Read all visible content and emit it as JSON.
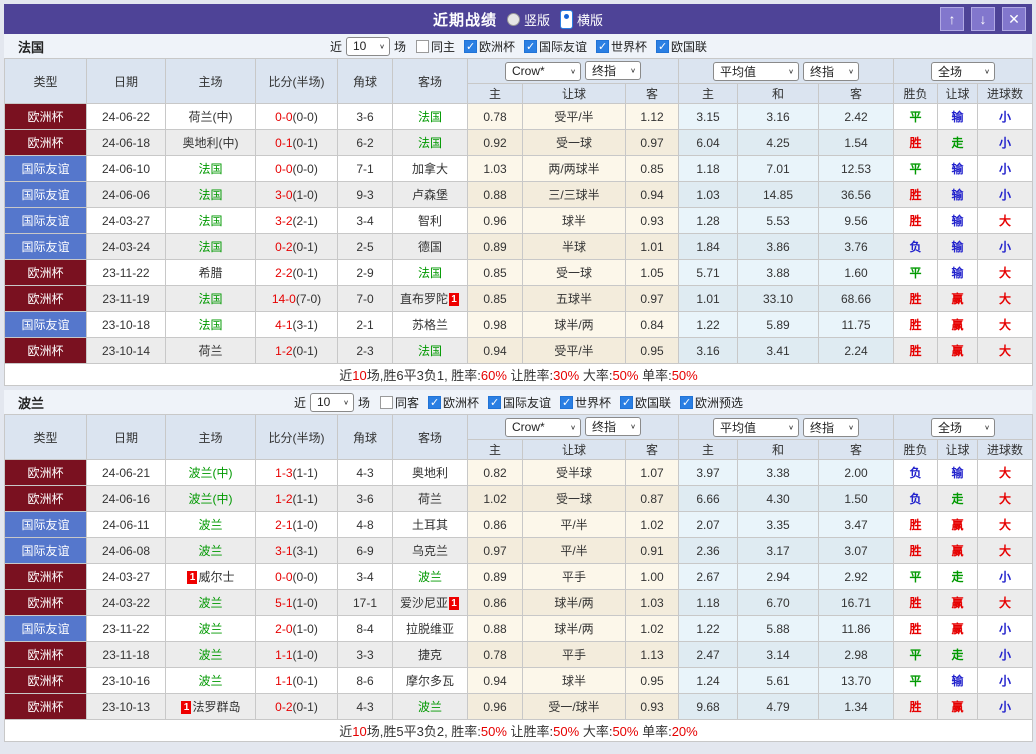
{
  "titlebar": {
    "title": "近期战绩",
    "layout_options": [
      {
        "label": "竖版",
        "selected": false
      },
      {
        "label": "横版",
        "selected": true
      }
    ],
    "buttons": [
      {
        "name": "move-up",
        "glyph": "↑"
      },
      {
        "name": "move-down",
        "glyph": "↓"
      },
      {
        "name": "close",
        "glyph": "✕"
      }
    ]
  },
  "table_header": {
    "static_cols": [
      "类型",
      "日期",
      "主场",
      "比分(半场)",
      "角球",
      "客场"
    ],
    "odds_group": {
      "selects": [
        "Crow*",
        "终指"
      ],
      "sub": [
        "主",
        "让球",
        "客"
      ]
    },
    "avg_group": {
      "selects": [
        "平均值",
        "终指"
      ],
      "sub": [
        "主",
        "和",
        "客"
      ]
    },
    "result_group": {
      "selects": [
        "全场"
      ],
      "sub": [
        "胜负",
        "让球",
        "进球数"
      ]
    }
  },
  "colors": {
    "titlebar_bg": "#4e4397",
    "type": {
      "欧洲杯": "#7a1120",
      "国际友谊": "#5577cc"
    },
    "result": {
      "胜": "#e60000",
      "平": "#009900",
      "负": "#2222cc",
      "赢": "#e60000",
      "走": "#009900",
      "输": "#2222cc",
      "大": "#e60000",
      "小": "#2222cc"
    },
    "team_green": "#009900",
    "score_red": "#e60000"
  },
  "card_glyph": "1",
  "sections": [
    {
      "team": "法国",
      "filter": {
        "prefix": "近",
        "count": "10",
        "suffix": "场",
        "same": {
          "label": "同主",
          "checked": false
        },
        "leagues": [
          {
            "label": "欧洲杯",
            "checked": true
          },
          {
            "label": "国际友谊",
            "checked": true
          },
          {
            "label": "世界杯",
            "checked": true
          },
          {
            "label": "欧国联",
            "checked": true
          }
        ]
      },
      "rows": [
        {
          "t": "欧洲杯",
          "d": "24-06-22",
          "h": "荷兰(中)",
          "hg": false,
          "hc": false,
          "s": "0-0",
          "sh": "0-0",
          "c": "3-6",
          "a": "法国",
          "ag": true,
          "ac": false,
          "o": [
            "0.78",
            "受平/半",
            "1.12"
          ],
          "m": [
            "3.15",
            "3.16",
            "2.42"
          ],
          "r": [
            "平",
            "输",
            "小"
          ]
        },
        {
          "t": "欧洲杯",
          "d": "24-06-18",
          "h": "奥地利(中)",
          "hg": false,
          "hc": false,
          "s": "0-1",
          "sh": "0-1",
          "c": "6-2",
          "a": "法国",
          "ag": true,
          "ac": false,
          "o": [
            "0.92",
            "受一球",
            "0.97"
          ],
          "m": [
            "6.04",
            "4.25",
            "1.54"
          ],
          "r": [
            "胜",
            "走",
            "小"
          ]
        },
        {
          "t": "国际友谊",
          "d": "24-06-10",
          "h": "法国",
          "hg": true,
          "hc": false,
          "s": "0-0",
          "sh": "0-0",
          "c": "7-1",
          "a": "加拿大",
          "ag": false,
          "ac": false,
          "o": [
            "1.03",
            "两/两球半",
            "0.85"
          ],
          "m": [
            "1.18",
            "7.01",
            "12.53"
          ],
          "r": [
            "平",
            "输",
            "小"
          ]
        },
        {
          "t": "国际友谊",
          "d": "24-06-06",
          "h": "法国",
          "hg": true,
          "hc": false,
          "s": "3-0",
          "sh": "1-0",
          "c": "9-3",
          "a": "卢森堡",
          "ag": false,
          "ac": false,
          "o": [
            "0.88",
            "三/三球半",
            "0.94"
          ],
          "m": [
            "1.03",
            "14.85",
            "36.56"
          ],
          "r": [
            "胜",
            "输",
            "小"
          ]
        },
        {
          "t": "国际友谊",
          "d": "24-03-27",
          "h": "法国",
          "hg": true,
          "hc": false,
          "s": "3-2",
          "sh": "2-1",
          "c": "3-4",
          "a": "智利",
          "ag": false,
          "ac": false,
          "o": [
            "0.96",
            "球半",
            "0.93"
          ],
          "m": [
            "1.28",
            "5.53",
            "9.56"
          ],
          "r": [
            "胜",
            "输",
            "大"
          ]
        },
        {
          "t": "国际友谊",
          "d": "24-03-24",
          "h": "法国",
          "hg": true,
          "hc": false,
          "s": "0-2",
          "sh": "0-1",
          "c": "2-5",
          "a": "德国",
          "ag": false,
          "ac": false,
          "o": [
            "0.89",
            "半球",
            "1.01"
          ],
          "m": [
            "1.84",
            "3.86",
            "3.76"
          ],
          "r": [
            "负",
            "输",
            "小"
          ]
        },
        {
          "t": "欧洲杯",
          "d": "23-11-22",
          "h": "希腊",
          "hg": false,
          "hc": false,
          "s": "2-2",
          "sh": "0-1",
          "c": "2-9",
          "a": "法国",
          "ag": true,
          "ac": false,
          "o": [
            "0.85",
            "受一球",
            "1.05"
          ],
          "m": [
            "5.71",
            "3.88",
            "1.60"
          ],
          "r": [
            "平",
            "输",
            "大"
          ]
        },
        {
          "t": "欧洲杯",
          "d": "23-11-19",
          "h": "法国",
          "hg": true,
          "hc": false,
          "s": "14-0",
          "sh": "7-0",
          "c": "7-0",
          "a": "直布罗陀",
          "ag": false,
          "ac": true,
          "o": [
            "0.85",
            "五球半",
            "0.97"
          ],
          "m": [
            "1.01",
            "33.10",
            "68.66"
          ],
          "r": [
            "胜",
            "赢",
            "大"
          ]
        },
        {
          "t": "国际友谊",
          "d": "23-10-18",
          "h": "法国",
          "hg": true,
          "hc": false,
          "s": "4-1",
          "sh": "3-1",
          "c": "2-1",
          "a": "苏格兰",
          "ag": false,
          "ac": false,
          "o": [
            "0.98",
            "球半/两",
            "0.84"
          ],
          "m": [
            "1.22",
            "5.89",
            "11.75"
          ],
          "r": [
            "胜",
            "赢",
            "大"
          ]
        },
        {
          "t": "欧洲杯",
          "d": "23-10-14",
          "h": "荷兰",
          "hg": false,
          "hc": false,
          "s": "1-2",
          "sh": "0-1",
          "c": "2-3",
          "a": "法国",
          "ag": true,
          "ac": false,
          "o": [
            "0.94",
            "受平/半",
            "0.95"
          ],
          "m": [
            "3.16",
            "3.41",
            "2.24"
          ],
          "r": [
            "胜",
            "赢",
            "大"
          ]
        }
      ],
      "summary": [
        [
          "近",
          0
        ],
        [
          "10",
          1
        ],
        [
          "场,胜6平3负1, 胜率:",
          0
        ],
        [
          "60%",
          1
        ],
        [
          " 让胜率:",
          0
        ],
        [
          "30%",
          1
        ],
        [
          " 大率:",
          0
        ],
        [
          "50%",
          1
        ],
        [
          " 单率:",
          0
        ],
        [
          "50%",
          1
        ]
      ]
    },
    {
      "team": "波兰",
      "filter": {
        "prefix": "近",
        "count": "10",
        "suffix": "场",
        "same": {
          "label": "同客",
          "checked": false
        },
        "leagues": [
          {
            "label": "欧洲杯",
            "checked": true
          },
          {
            "label": "国际友谊",
            "checked": true
          },
          {
            "label": "世界杯",
            "checked": true
          },
          {
            "label": "欧国联",
            "checked": true
          },
          {
            "label": "欧洲预选",
            "checked": true
          }
        ]
      },
      "rows": [
        {
          "t": "欧洲杯",
          "d": "24-06-21",
          "h": "波兰(中)",
          "hg": true,
          "hc": false,
          "s": "1-3",
          "sh": "1-1",
          "c": "4-3",
          "a": "奥地利",
          "ag": false,
          "ac": false,
          "o": [
            "0.82",
            "受半球",
            "1.07"
          ],
          "m": [
            "3.97",
            "3.38",
            "2.00"
          ],
          "r": [
            "负",
            "输",
            "大"
          ]
        },
        {
          "t": "欧洲杯",
          "d": "24-06-16",
          "h": "波兰(中)",
          "hg": true,
          "hc": false,
          "s": "1-2",
          "sh": "1-1",
          "c": "3-6",
          "a": "荷兰",
          "ag": false,
          "ac": false,
          "o": [
            "1.02",
            "受一球",
            "0.87"
          ],
          "m": [
            "6.66",
            "4.30",
            "1.50"
          ],
          "r": [
            "负",
            "走",
            "大"
          ]
        },
        {
          "t": "国际友谊",
          "d": "24-06-11",
          "h": "波兰",
          "hg": true,
          "hc": false,
          "s": "2-1",
          "sh": "1-0",
          "c": "4-8",
          "a": "土耳其",
          "ag": false,
          "ac": false,
          "o": [
            "0.86",
            "平/半",
            "1.02"
          ],
          "m": [
            "2.07",
            "3.35",
            "3.47"
          ],
          "r": [
            "胜",
            "赢",
            "大"
          ]
        },
        {
          "t": "国际友谊",
          "d": "24-06-08",
          "h": "波兰",
          "hg": true,
          "hc": false,
          "s": "3-1",
          "sh": "3-1",
          "c": "6-9",
          "a": "乌克兰",
          "ag": false,
          "ac": false,
          "o": [
            "0.97",
            "平/半",
            "0.91"
          ],
          "m": [
            "2.36",
            "3.17",
            "3.07"
          ],
          "r": [
            "胜",
            "赢",
            "大"
          ]
        },
        {
          "t": "欧洲杯",
          "d": "24-03-27",
          "h": "威尔士",
          "hg": false,
          "hc": true,
          "s": "0-0",
          "sh": "0-0",
          "c": "3-4",
          "a": "波兰",
          "ag": true,
          "ac": false,
          "o": [
            "0.89",
            "平手",
            "1.00"
          ],
          "m": [
            "2.67",
            "2.94",
            "2.92"
          ],
          "r": [
            "平",
            "走",
            "小"
          ]
        },
        {
          "t": "欧洲杯",
          "d": "24-03-22",
          "h": "波兰",
          "hg": true,
          "hc": false,
          "s": "5-1",
          "sh": "1-0",
          "c": "17-1",
          "a": "爱沙尼亚",
          "ag": false,
          "ac": true,
          "o": [
            "0.86",
            "球半/两",
            "1.03"
          ],
          "m": [
            "1.18",
            "6.70",
            "16.71"
          ],
          "r": [
            "胜",
            "赢",
            "大"
          ]
        },
        {
          "t": "国际友谊",
          "d": "23-11-22",
          "h": "波兰",
          "hg": true,
          "hc": false,
          "s": "2-0",
          "sh": "1-0",
          "c": "8-4",
          "a": "拉脱维亚",
          "ag": false,
          "ac": false,
          "o": [
            "0.88",
            "球半/两",
            "1.02"
          ],
          "m": [
            "1.22",
            "5.88",
            "11.86"
          ],
          "r": [
            "胜",
            "赢",
            "小"
          ]
        },
        {
          "t": "欧洲杯",
          "d": "23-11-18",
          "h": "波兰",
          "hg": true,
          "hc": false,
          "s": "1-1",
          "sh": "1-0",
          "c": "3-3",
          "a": "捷克",
          "ag": false,
          "ac": false,
          "o": [
            "0.78",
            "平手",
            "1.13"
          ],
          "m": [
            "2.47",
            "3.14",
            "2.98"
          ],
          "r": [
            "平",
            "走",
            "小"
          ]
        },
        {
          "t": "欧洲杯",
          "d": "23-10-16",
          "h": "波兰",
          "hg": true,
          "hc": false,
          "s": "1-1",
          "sh": "0-1",
          "c": "8-6",
          "a": "摩尔多瓦",
          "ag": false,
          "ac": false,
          "o": [
            "0.94",
            "球半",
            "0.95"
          ],
          "m": [
            "1.24",
            "5.61",
            "13.70"
          ],
          "r": [
            "平",
            "输",
            "小"
          ]
        },
        {
          "t": "欧洲杯",
          "d": "23-10-13",
          "h": "法罗群岛",
          "hg": false,
          "hc": true,
          "s": "0-2",
          "sh": "0-1",
          "c": "4-3",
          "a": "波兰",
          "ag": true,
          "ac": false,
          "o": [
            "0.96",
            "受一/球半",
            "0.93"
          ],
          "m": [
            "9.68",
            "4.79",
            "1.34"
          ],
          "r": [
            "胜",
            "赢",
            "小"
          ]
        }
      ],
      "summary": [
        [
          "近",
          0
        ],
        [
          "10",
          1
        ],
        [
          "场,胜5平3负2, 胜率:",
          0
        ],
        [
          "50%",
          1
        ],
        [
          " 让胜率:",
          0
        ],
        [
          "50%",
          1
        ],
        [
          " 大率:",
          0
        ],
        [
          "50%",
          1
        ],
        [
          " 单率:",
          0
        ],
        [
          "20%",
          1
        ]
      ]
    }
  ]
}
